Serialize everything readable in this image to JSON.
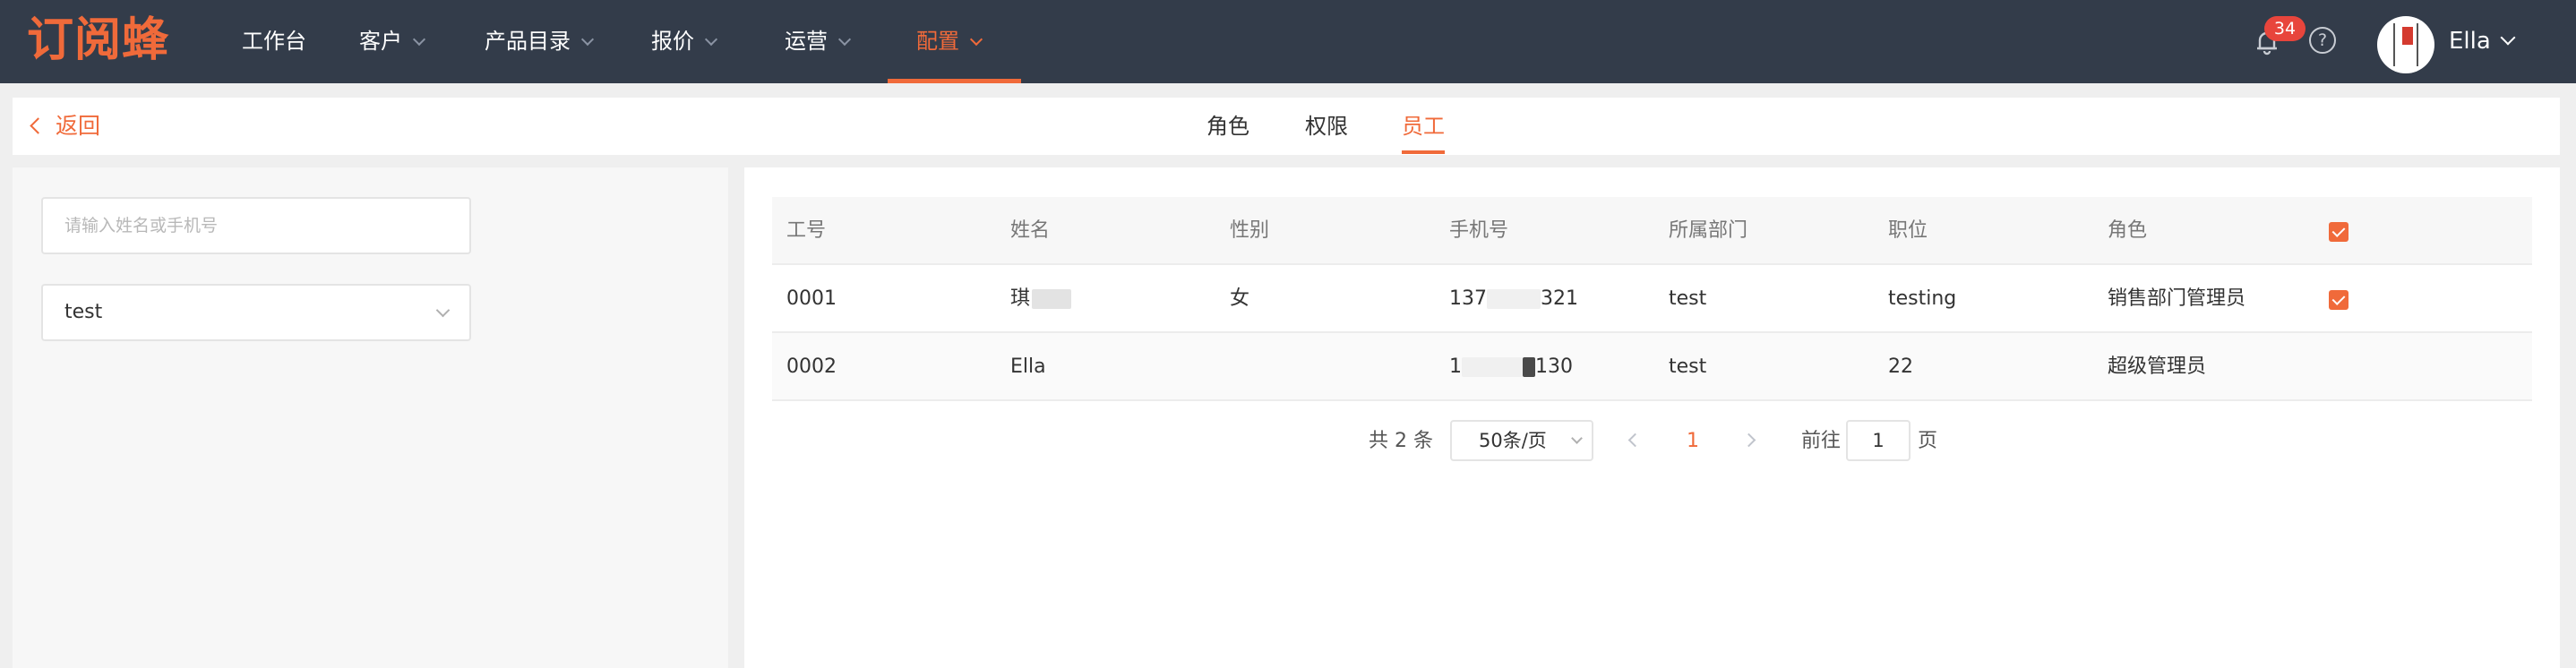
{
  "brand": {
    "logo_text": "订阅蜂",
    "accent": "#f06a3a",
    "topbar_bg": "#333c4a"
  },
  "nav": [
    {
      "label": "工作台",
      "has_caret": false
    },
    {
      "label": "客户",
      "has_caret": true
    },
    {
      "label": "产品目录",
      "has_caret": true
    },
    {
      "label": "报价",
      "has_caret": true
    },
    {
      "label": "运营",
      "has_caret": true
    },
    {
      "label": "配置",
      "has_caret": true,
      "active": true
    }
  ],
  "header_right": {
    "notification_count": "34",
    "help_icon": "?",
    "user_name": "Ella"
  },
  "subbar": {
    "back_label": "返回",
    "tabs": [
      {
        "label": "角色"
      },
      {
        "label": "权限"
      },
      {
        "label": "员工",
        "active": true
      }
    ]
  },
  "filter": {
    "search_placeholder": "请输入姓名或手机号",
    "search_value": "",
    "select_value": "test"
  },
  "table": {
    "headers": [
      "工号",
      "姓名",
      "性别",
      "手机号",
      "所属部门",
      "职位",
      "角色"
    ],
    "header_checked": true,
    "rows": [
      {
        "id": "0001",
        "name": "琪",
        "gender": "女",
        "phone_prefix": "137",
        "phone_suffix": "321",
        "dept": "test",
        "position": "testing",
        "role": "销售部门管理员",
        "checked": true
      },
      {
        "id": "0002",
        "name": "Ella",
        "gender": "",
        "phone_prefix": "1",
        "phone_suffix": "130",
        "dept": "test",
        "position": "22",
        "role": "超级管理员",
        "checked": false
      }
    ]
  },
  "pagination": {
    "total_text": "共 2 条",
    "page_size": "50条/页",
    "current_page": "1",
    "goto_label": "前往",
    "goto_value": "1",
    "page_unit": "页"
  }
}
